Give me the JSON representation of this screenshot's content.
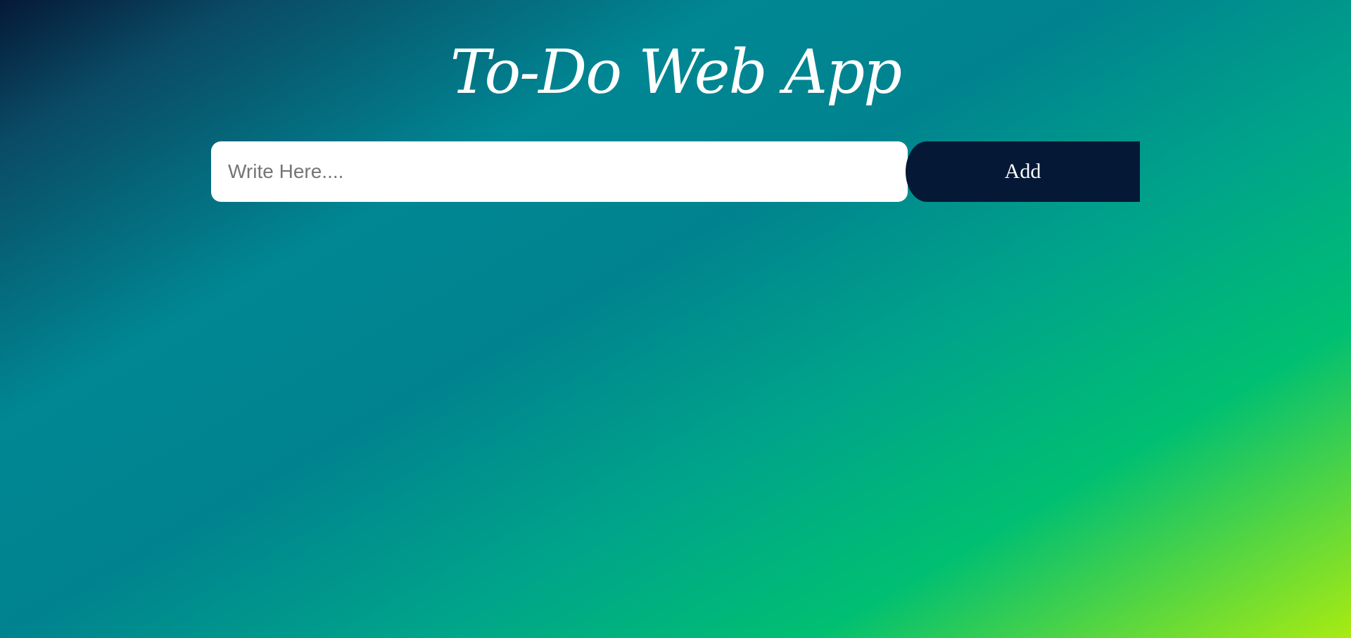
{
  "header": {
    "title": "To-Do Web App"
  },
  "form": {
    "input_placeholder": "Write Here....",
    "input_value": "",
    "add_label": "Add"
  },
  "tasks": [],
  "colors": {
    "button_bg": "#051937",
    "input_bg": "#ffffff",
    "title_text": "#ffffff",
    "gradient_start": "#051937",
    "gradient_mid": "#008793",
    "gradient_green": "#00bf72",
    "gradient_end": "#a8eb12"
  }
}
